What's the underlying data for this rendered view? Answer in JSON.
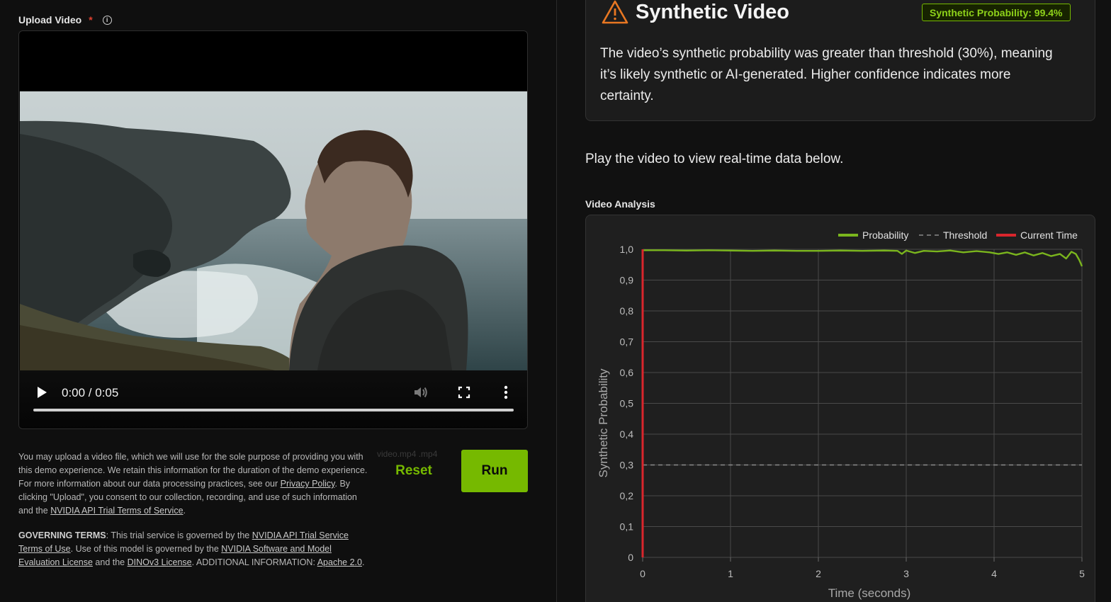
{
  "upload": {
    "label": "Upload Video",
    "required_mark": "*",
    "info_icon": "i"
  },
  "player": {
    "time": "0:00 / 0:05",
    "progress_fraction": 0.0
  },
  "formats_hint": "video.mp4   .mp4",
  "buttons": {
    "reset": "Reset",
    "run": "Run"
  },
  "disclaimer": {
    "part1": "You may upload a video file, which we will use for the sole purpose of providing you with this demo experience. We retain this information for the duration of the demo experience. For more information about our data processing practices, see our ",
    "privacy_link": "Privacy Policy",
    "part2": ". By clicking \"Upload\", you consent to our collection, recording, and use of such information and the ",
    "terms_link": "NVIDIA API Trial Terms of Service",
    "part3": "."
  },
  "governing": {
    "bold": "GOVERNING TERMS",
    "t1": ": This trial service is governed by the ",
    "link1": "NVIDIA API Trial Service Terms of Use",
    "t2": ". Use of this model is governed by the ",
    "link2": "NVIDIA Software and Model Evaluation License",
    "t3": " and the ",
    "link3": "DINOv3 License",
    "t4": ". ADDITIONAL INFORMATION: ",
    "link4": "Apache 2.0",
    "t5": "."
  },
  "result": {
    "title": "Synthetic Video",
    "badge": "Synthetic Probability: 99.4%",
    "description": "The video’s synthetic probability was greater than threshold (30%), meaning it’s likely synthetic or AI-generated. Higher confidence indicates more certainty."
  },
  "play_hint": "Play the video to view real-time data below.",
  "chart_label": "Video Analysis",
  "colors": {
    "accent": "#76b900",
    "probability_line": "#7ab51d",
    "threshold_line": "#8a8a8a",
    "current_time_line": "#d9262c",
    "warning": "#e87722"
  },
  "chart_data": {
    "type": "line",
    "xlabel": "Time (seconds)",
    "ylabel": "Synthetic Probability",
    "xlim": [
      0,
      5
    ],
    "ylim": [
      0,
      1
    ],
    "x_ticks": [
      "0",
      "1",
      "2",
      "3",
      "4",
      "5"
    ],
    "y_ticks": [
      "0",
      "0,1",
      "0,2",
      "0,3",
      "0,4",
      "0,5",
      "0,6",
      "0,7",
      "0,8",
      "0,9",
      "1,0"
    ],
    "legend": [
      "Probability",
      "Threshold",
      "Current Time"
    ],
    "legend_position": "top-right",
    "grid": true,
    "series": [
      {
        "name": "Probability",
        "x": [
          0,
          0.25,
          0.5,
          0.75,
          1.0,
          1.25,
          1.5,
          1.75,
          2.0,
          2.25,
          2.5,
          2.75,
          2.9,
          2.95,
          3.0,
          3.1,
          3.2,
          3.35,
          3.5,
          3.65,
          3.8,
          3.95,
          4.05,
          4.15,
          4.25,
          4.35,
          4.45,
          4.55,
          4.65,
          4.75,
          4.82,
          4.88,
          4.93,
          4.97,
          5.0
        ],
        "y": [
          0.997,
          0.997,
          0.996,
          0.997,
          0.996,
          0.995,
          0.996,
          0.995,
          0.995,
          0.996,
          0.995,
          0.996,
          0.995,
          0.985,
          0.996,
          0.988,
          0.995,
          0.993,
          0.996,
          0.99,
          0.994,
          0.99,
          0.985,
          0.99,
          0.982,
          0.99,
          0.98,
          0.988,
          0.978,
          0.985,
          0.97,
          0.992,
          0.985,
          0.965,
          0.945
        ]
      },
      {
        "name": "Threshold",
        "value": 0.3
      },
      {
        "name": "Current Time",
        "value": 0
      }
    ]
  }
}
